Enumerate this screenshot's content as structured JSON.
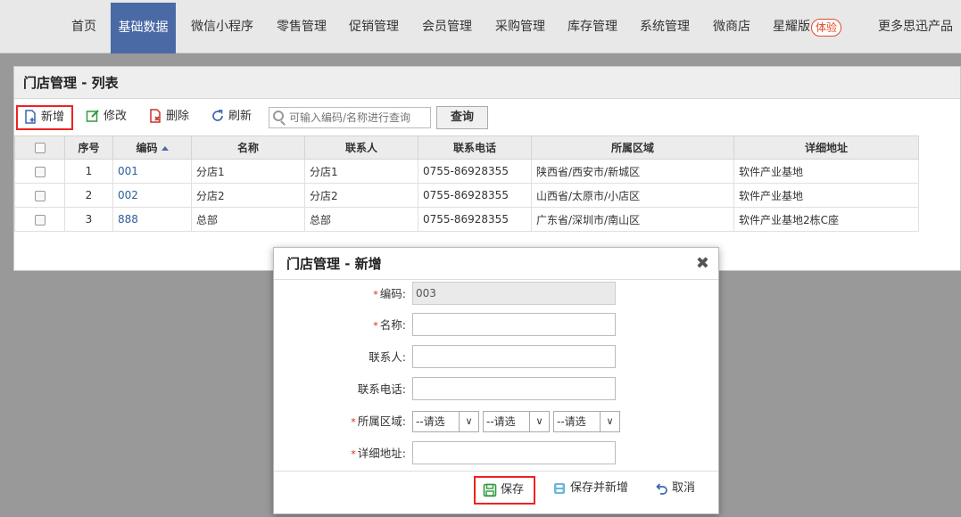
{
  "nav": {
    "items": [
      "首页",
      "基础数据",
      "微信小程序",
      "零售管理",
      "促销管理",
      "会员管理",
      "采购管理",
      "库存管理",
      "系统管理",
      "微商店",
      "星耀版",
      "更多思迅产品"
    ],
    "badge": "体验",
    "active": "基础数据"
  },
  "panel": {
    "title": "门店管理 - 列表",
    "toolbar": {
      "add": "新增",
      "edit": "修改",
      "delete": "删除",
      "refresh": "刷新",
      "search_placeholder": "可输入编码/名称进行查询",
      "query": "查询"
    },
    "columns": [
      "序号",
      "编码",
      "名称",
      "联系人",
      "联系电话",
      "所属区域",
      "详细地址"
    ],
    "rows": [
      {
        "no": "1",
        "code": "001",
        "name": "分店1",
        "contact": "分店1",
        "phone": "0755-86928355",
        "region": "陕西省/西安市/新城区",
        "address": "软件产业基地"
      },
      {
        "no": "2",
        "code": "002",
        "name": "分店2",
        "contact": "分店2",
        "phone": "0755-86928355",
        "region": "山西省/太原市/小店区",
        "address": "软件产业基地"
      },
      {
        "no": "3",
        "code": "888",
        "name": "总部",
        "contact": "总部",
        "phone": "0755-86928355",
        "region": "广东省/深圳市/南山区",
        "address": "软件产业基地2栋C座"
      }
    ]
  },
  "dialog": {
    "title": "门店管理 - 新增",
    "close": "✖",
    "fields": {
      "code_label": "编码:",
      "code_value": "003",
      "name_label": "名称:",
      "contact_label": "联系人:",
      "phone_label": "联系电话:",
      "region_label": "所属区域:",
      "region_select": "--请选",
      "address_label": "详细地址:"
    },
    "buttons": {
      "save": "保存",
      "save_new": "保存并新增",
      "cancel": "取消"
    }
  },
  "colors": {
    "nav_active": "#4a6aa5",
    "highlight": "#e22222",
    "link": "#2a5e9a"
  }
}
